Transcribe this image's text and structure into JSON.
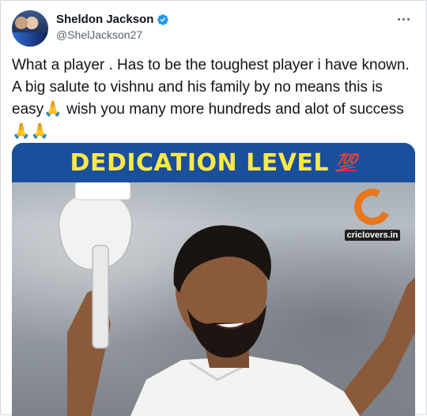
{
  "author": {
    "name": "Sheldon Jackson",
    "handle": "@ShelJackson27",
    "verified": true
  },
  "icons": {
    "avatar": "avatar",
    "verified": "verified-badge-icon",
    "more": "more-options-icon",
    "logo": "criclovers-logo"
  },
  "tweet": {
    "text": "What a player . Has to be the toughest player i have known. A big salute to vishnu and his family by no means this is easy🙏 wish you many more hundreds and alot of success 🙏🙏"
  },
  "media": {
    "banner_text": "DEDICATION LEVEL",
    "banner_emoji": "💯",
    "logo_text": "criclovers.in"
  },
  "colors": {
    "banner_bg": "#1a4f9c",
    "banner_text": "#ffe84a",
    "verified": "#1d9bf0",
    "handle": "#536471",
    "logo_orange": "#e8761c"
  }
}
